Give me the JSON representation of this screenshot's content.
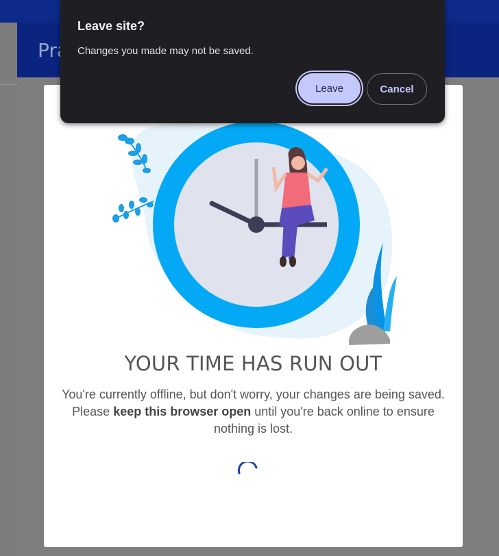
{
  "page": {
    "header_title": "Pra"
  },
  "modal": {
    "heading": "YOUR TIME HAS RUN OUT",
    "message_part1": "You're currently offline, but don't worry, your changes are being saved. Please ",
    "message_bold": "keep this browser open",
    "message_part2": " until you're back online to ensure nothing is lost."
  },
  "dialog": {
    "title": "Leave site?",
    "message": "Changes you made may not be saved.",
    "leave_label": "Leave",
    "cancel_label": "Cancel"
  },
  "colors": {
    "header": "#0a2480",
    "clock_ring": "#03a9f4",
    "spinner": "#1e3fa8",
    "dialog_bg": "#1f1f23",
    "leave_button": "#c4c8fb"
  },
  "icons": {
    "spinner": "loading-spinner-icon",
    "illustration": "clock-illustration"
  }
}
